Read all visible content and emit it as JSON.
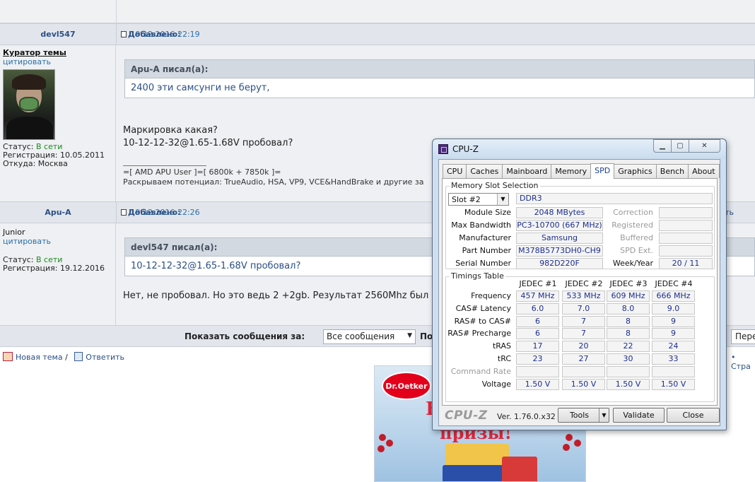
{
  "forum": {
    "post1": {
      "author": "devl547",
      "added_label": "Добавлено:",
      "added_date": "19.12.2016 22:19",
      "user_title": "Куратор темы",
      "cite": "цитировать",
      "status_label": "Статус:",
      "status_value": "В сети",
      "reg": "Регистрация: 10.05.2011",
      "from": "Откуда: Москва",
      "quote_head": "Apu-A писал(а):",
      "quote_text": "2400 эти самсунги не берут,",
      "line1": "Маркировка какая?",
      "line2": "10-12-12-32@1.65-1.68V пробовал?",
      "sig1": "=[ AMD APU User ]=[ 6800k + 7850k ]=",
      "sig2": "Раскрываем потенциал: TrueAudio, HSA, VP9, VCE&HandBrake и другие за"
    },
    "post2": {
      "author": "Apu-A",
      "added_label": "Добавлено:",
      "added_date": "19.12.2016 22:26",
      "quote_right": "ровать",
      "user_title": "Junior",
      "cite": "цитировать",
      "status_label": "Статус:",
      "status_value": "В сети",
      "reg": "Регистрация: 19.12.2016",
      "quote_head": "devl547 писал(а):",
      "quote_text": "10-12-12-32@1.65-1.68V пробовал?",
      "line1": "Нет, не пробовал. Но это ведь 2 +2gb. Результат 2560Mhz был"
    },
    "bottom": {
      "show_label": "Показать сообщения за:",
      "select_value": "Все сообщения",
      "po_label": "По",
      "pere_label": "Пере"
    },
    "actions": {
      "new_topic": "Новая тема",
      "separator": "/",
      "reply": "Ответить",
      "strana": "• Стра"
    },
    "ad": {
      "brand": "Dr.Oetker",
      "big_letter": "В",
      "big_word": "призы!"
    }
  },
  "cpuz": {
    "title": "CPU-Z",
    "tabs": [
      "CPU",
      "Caches",
      "Mainboard",
      "Memory",
      "SPD",
      "Graphics",
      "Bench",
      "About"
    ],
    "active_tab": "SPD",
    "slot_group_title": "Memory Slot Selection",
    "slot_value": "Slot #2",
    "mem_type": "DDR3",
    "left_rows": [
      {
        "label": "Module Size",
        "value": "2048 MBytes"
      },
      {
        "label": "Max Bandwidth",
        "value": "PC3-10700 (667 MHz)"
      },
      {
        "label": "Manufacturer",
        "value": "Samsung"
      },
      {
        "label": "Part Number",
        "value": "M378B5773DH0-CH9"
      },
      {
        "label": "Serial Number",
        "value": "982D220F"
      }
    ],
    "right_rows": [
      {
        "label": "Correction",
        "value": ""
      },
      {
        "label": "Registered",
        "value": ""
      },
      {
        "label": "Buffered",
        "value": ""
      },
      {
        "label": "SPD Ext.",
        "value": ""
      },
      {
        "label": "Week/Year",
        "value": "20 / 11"
      }
    ],
    "timings_title": "Timings Table",
    "columns": [
      "JEDEC #1",
      "JEDEC #2",
      "JEDEC #3",
      "JEDEC #4"
    ],
    "timings": [
      {
        "label": "Frequency",
        "values": [
          "457 MHz",
          "533 MHz",
          "609 MHz",
          "666 MHz"
        ]
      },
      {
        "label": "CAS# Latency",
        "values": [
          "6.0",
          "7.0",
          "8.0",
          "9.0"
        ]
      },
      {
        "label": "RAS# to CAS#",
        "values": [
          "6",
          "7",
          "8",
          "9"
        ]
      },
      {
        "label": "RAS# Precharge",
        "values": [
          "6",
          "7",
          "8",
          "9"
        ]
      },
      {
        "label": "tRAS",
        "values": [
          "17",
          "20",
          "22",
          "24"
        ]
      },
      {
        "label": "tRC",
        "values": [
          "23",
          "27",
          "30",
          "33"
        ]
      },
      {
        "label": "Command Rate",
        "values": [
          "",
          "",
          "",
          ""
        ]
      },
      {
        "label": "Voltage",
        "values": [
          "1.50 V",
          "1.50 V",
          "1.50 V",
          "1.50 V"
        ]
      }
    ],
    "footer": {
      "brand": "CPU-Z",
      "version": "Ver. 1.76.0.x32",
      "tools": "Tools",
      "validate": "Validate",
      "close": "Close"
    }
  }
}
